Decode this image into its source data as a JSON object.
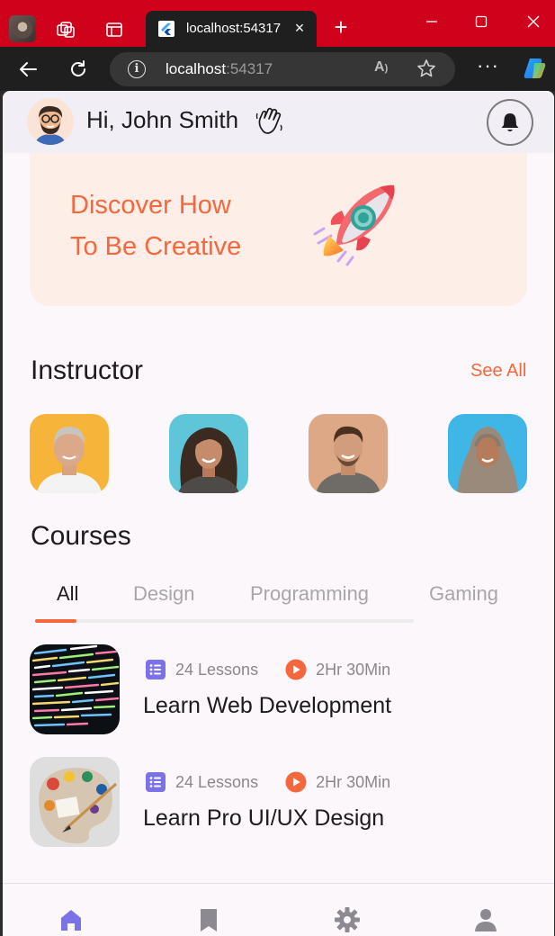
{
  "browser": {
    "tab_title": "localhost:54317",
    "url_host": "localhost",
    "url_port": ":54317",
    "read_aloud_label": "Á"
  },
  "app": {
    "greeting": "Hi, John Smith",
    "banner": {
      "line1": "Discover How",
      "line2": "To Be Creative"
    },
    "instructor_section": {
      "title": "Instructor",
      "see_all": "See All"
    },
    "courses_section": {
      "title": "Courses",
      "tabs": [
        "All",
        "Design",
        "Programming",
        "Gaming"
      ],
      "active_tab": "All"
    },
    "courses": [
      {
        "title": "Learn Web Development",
        "lessons": "24 Lessons",
        "duration": "2Hr 30Min"
      },
      {
        "title": "Learn Pro UI/UX Design",
        "lessons": "24 Lessons",
        "duration": "2Hr 30Min"
      }
    ],
    "bottom_nav": [
      "home-icon",
      "bookmark-icon",
      "settings-icon",
      "profile-icon"
    ],
    "colors": {
      "accent": "#f5673c",
      "nav_active": "#7b72e9",
      "nav_inactive": "#8c8a90",
      "lesson_icon": "#7b72e9"
    }
  }
}
